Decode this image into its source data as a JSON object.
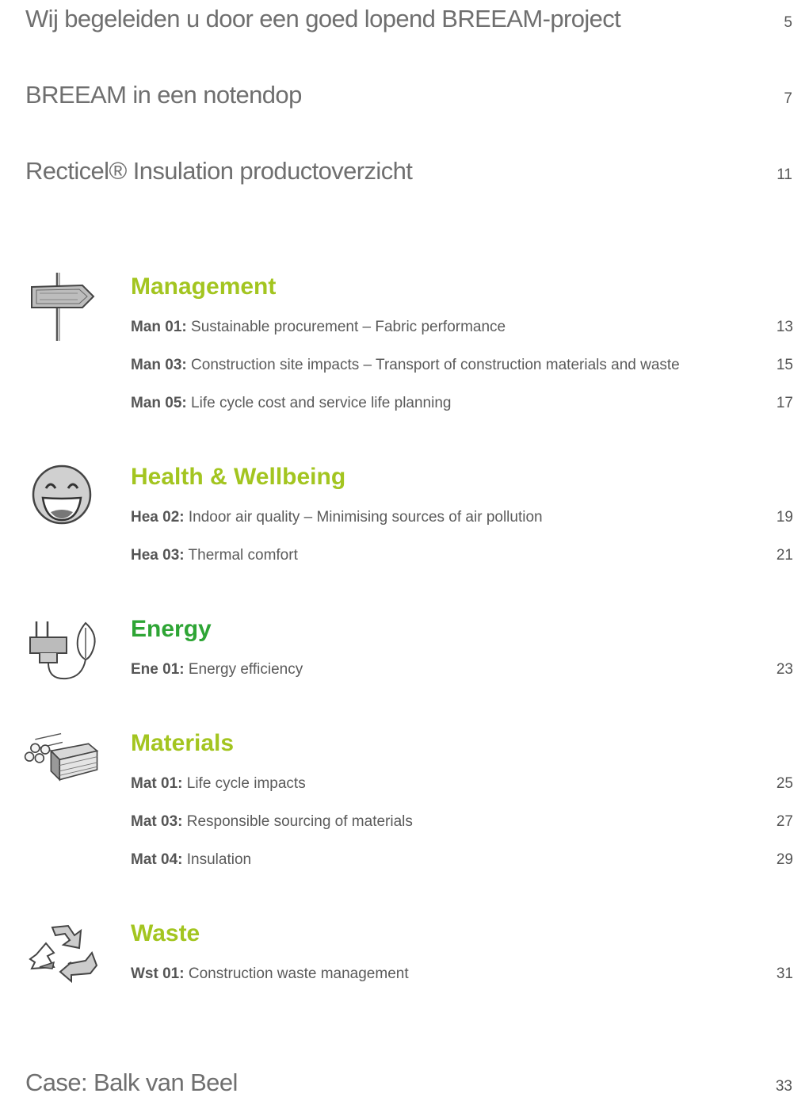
{
  "intro_entries": [
    {
      "title": "Wij begeleiden u door een goed lopend BREEAM-project",
      "page": "5"
    },
    {
      "title": "BREEAM in een notendop",
      "page": "7"
    },
    {
      "title": "Recticel® Insulation productoverzicht",
      "page": "11"
    }
  ],
  "colors": {
    "accent_lime": "#a3c520",
    "accent_green": "#2ea535",
    "text_gray": "#555555"
  },
  "sections": [
    {
      "heading": "Management",
      "icon": "signpost-icon",
      "items": [
        {
          "code": "Man 01:",
          "text": " Sustainable procurement – Fabric performance",
          "page": "13"
        },
        {
          "code": "Man 03:",
          "text": " Construction site impacts – Transport of construction materials and waste",
          "page": "15"
        },
        {
          "code": "Man 05:",
          "text": " Life cycle cost and service life planning",
          "page": "17"
        }
      ]
    },
    {
      "heading": "Health & Wellbeing",
      "icon": "smiley-face-icon",
      "items": [
        {
          "code": "Hea 02:",
          "text": " Indoor air quality – Minimising sources of air pollution",
          "page": "19"
        },
        {
          "code": "Hea 03:",
          "text": " Thermal comfort",
          "page": "21"
        }
      ]
    },
    {
      "heading": "Energy",
      "icon": "plug-leaf-icon",
      "items": [
        {
          "code": "Ene 01:",
          "text": " Energy efficiency",
          "page": "23"
        }
      ]
    },
    {
      "heading": "Materials",
      "icon": "logs-planks-icon",
      "items": [
        {
          "code": "Mat 01:",
          "text": " Life cycle impacts",
          "page": "25"
        },
        {
          "code": "Mat 03:",
          "text": " Responsible sourcing of materials",
          "page": "27"
        },
        {
          "code": "Mat 04:",
          "text": " Insulation",
          "page": "29"
        }
      ]
    },
    {
      "heading": "Waste",
      "icon": "recycle-icon",
      "items": [
        {
          "code": "Wst 01:",
          "text": " Construction waste management",
          "page": "31"
        }
      ]
    }
  ],
  "closing_entry": {
    "title": "Case: Balk van Beel",
    "page": "33"
  }
}
